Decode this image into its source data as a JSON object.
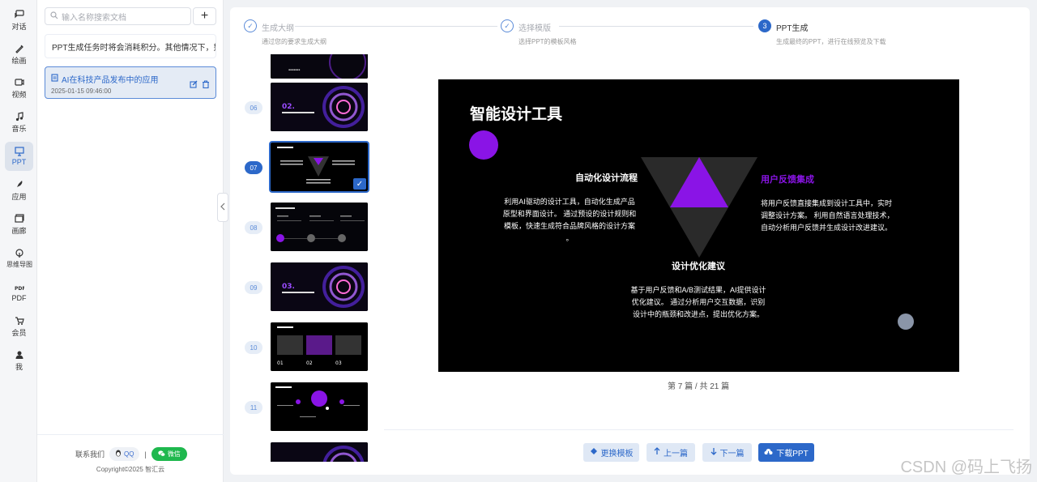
{
  "rail": {
    "items": [
      {
        "label": "对话",
        "icon": "chat-icon"
      },
      {
        "label": "绘画",
        "icon": "brush-icon"
      },
      {
        "label": "视频",
        "icon": "video-icon"
      },
      {
        "label": "音乐",
        "icon": "music-icon"
      },
      {
        "label": "PPT",
        "icon": "presentation-icon"
      },
      {
        "label": "应用",
        "icon": "rocket-icon"
      },
      {
        "label": "画廊",
        "icon": "gallery-icon"
      },
      {
        "label": "思维导图",
        "icon": "mindmap-icon"
      },
      {
        "label": "PDF",
        "icon": "pdf-icon"
      },
      {
        "label": "会员",
        "icon": "cart-icon"
      },
      {
        "label": "我",
        "icon": "user-icon"
      }
    ],
    "active_index": 4
  },
  "sidebar": {
    "search_placeholder": "输入名称搜索文档",
    "add_label": "+",
    "notice": "PPT生成任务时将会消耗积分。其他情况下，如",
    "doc": {
      "title": "AI在科技产品发布中的应用",
      "date": "2025-01-15 09:46:00"
    },
    "footer": {
      "contact": "联系我们",
      "qq": "QQ",
      "separator": "|",
      "wechat": "微信",
      "copyright": "Copyright©2025 智汇云"
    }
  },
  "steps": [
    {
      "title": "生成大纲",
      "desc": "通过您的要求生成大纲",
      "state": "done"
    },
    {
      "title": "选择模版",
      "desc": "选择PPT的模板风格",
      "state": "done"
    },
    {
      "number": "3",
      "title": "PPT生成",
      "desc": "生成最终的PPT，进行在线预览及下载",
      "state": "current"
    }
  ],
  "thumbnails": [
    {
      "num": "",
      "style": "dark-partial"
    },
    {
      "num": "06",
      "style": "sphere",
      "caption": "02."
    },
    {
      "num": "07",
      "style": "triangle",
      "active": true
    },
    {
      "num": "08",
      "style": "steps"
    },
    {
      "num": "09",
      "style": "sphere",
      "caption": "03."
    },
    {
      "num": "10",
      "style": "table"
    },
    {
      "num": "11",
      "style": "circles"
    },
    {
      "num": "",
      "style": "sphere-partial"
    }
  ],
  "slide": {
    "title": "智能设计工具",
    "left_title": "自动化设计流程",
    "left_body": [
      "利用AI驱动的设计工具，自动化生成产品",
      "原型和界面设计。 通过预设的设计规则和",
      "模板，快速生成符合品牌风格的设计方案",
      "。"
    ],
    "right_title": "用户反馈集成",
    "right_body": [
      "将用户反馈直接集成到设计工具中，实时",
      "调整设计方案。 利用自然语言处理技术，",
      "自动分析用户反馈并生成设计改进建议。"
    ],
    "bottom_title": "设计优化建议",
    "bottom_body": [
      "基于用户反馈和A/B测试结果，AI提供设计",
      "优化建议。 通过分析用户交互数据，识别",
      "设计中的瓶颈和改进点，提出优化方案。"
    ],
    "accent": "#8a14e6"
  },
  "pager": {
    "text": "第 7 篇 / 共 21 篇",
    "current": 7,
    "total": 21
  },
  "buttons": {
    "change_template": "更换模板",
    "prev": "上一篇",
    "next": "下一篇",
    "download": "下载PPT"
  },
  "watermark": "CSDN @码上飞扬"
}
